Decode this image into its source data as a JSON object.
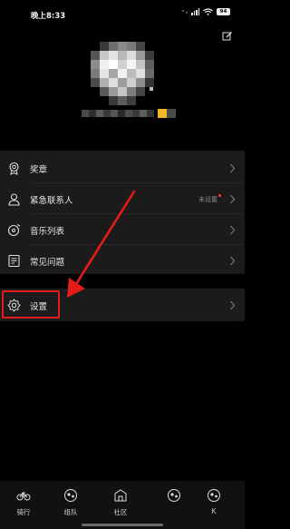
{
  "status_bar": {
    "time": "晚上8:33",
    "network": "ⁿ ᵢₗ",
    "battery": "94"
  },
  "menu": [
    {
      "id": "medal",
      "label": "奖章",
      "icon": "medal-icon"
    },
    {
      "id": "emergency-contact",
      "label": "紧急联系人",
      "icon": "contact-person-icon",
      "value": "未设置"
    },
    {
      "id": "music-list",
      "label": "音乐列表",
      "icon": "music-disc-icon"
    },
    {
      "id": "faq",
      "label": "常见问题",
      "icon": "document-icon"
    }
  ],
  "settings": {
    "label": "设置",
    "icon": "gear-icon"
  },
  "tabs": [
    {
      "id": "ride",
      "label": "骑行",
      "icon": "bicycle-icon"
    },
    {
      "id": "team",
      "label": "组队",
      "icon": "team-icon"
    },
    {
      "id": "community",
      "label": "社区",
      "icon": "community-icon"
    },
    {
      "id": "tab4",
      "label": "",
      "icon": "tab-icon"
    },
    {
      "id": "tab5",
      "label": "K",
      "icon": "tab-icon"
    }
  ],
  "colors": {
    "accent_red": "#e31b1b",
    "card_bg": "#1b1b1b",
    "highlight_yellow": "#f0b829"
  }
}
